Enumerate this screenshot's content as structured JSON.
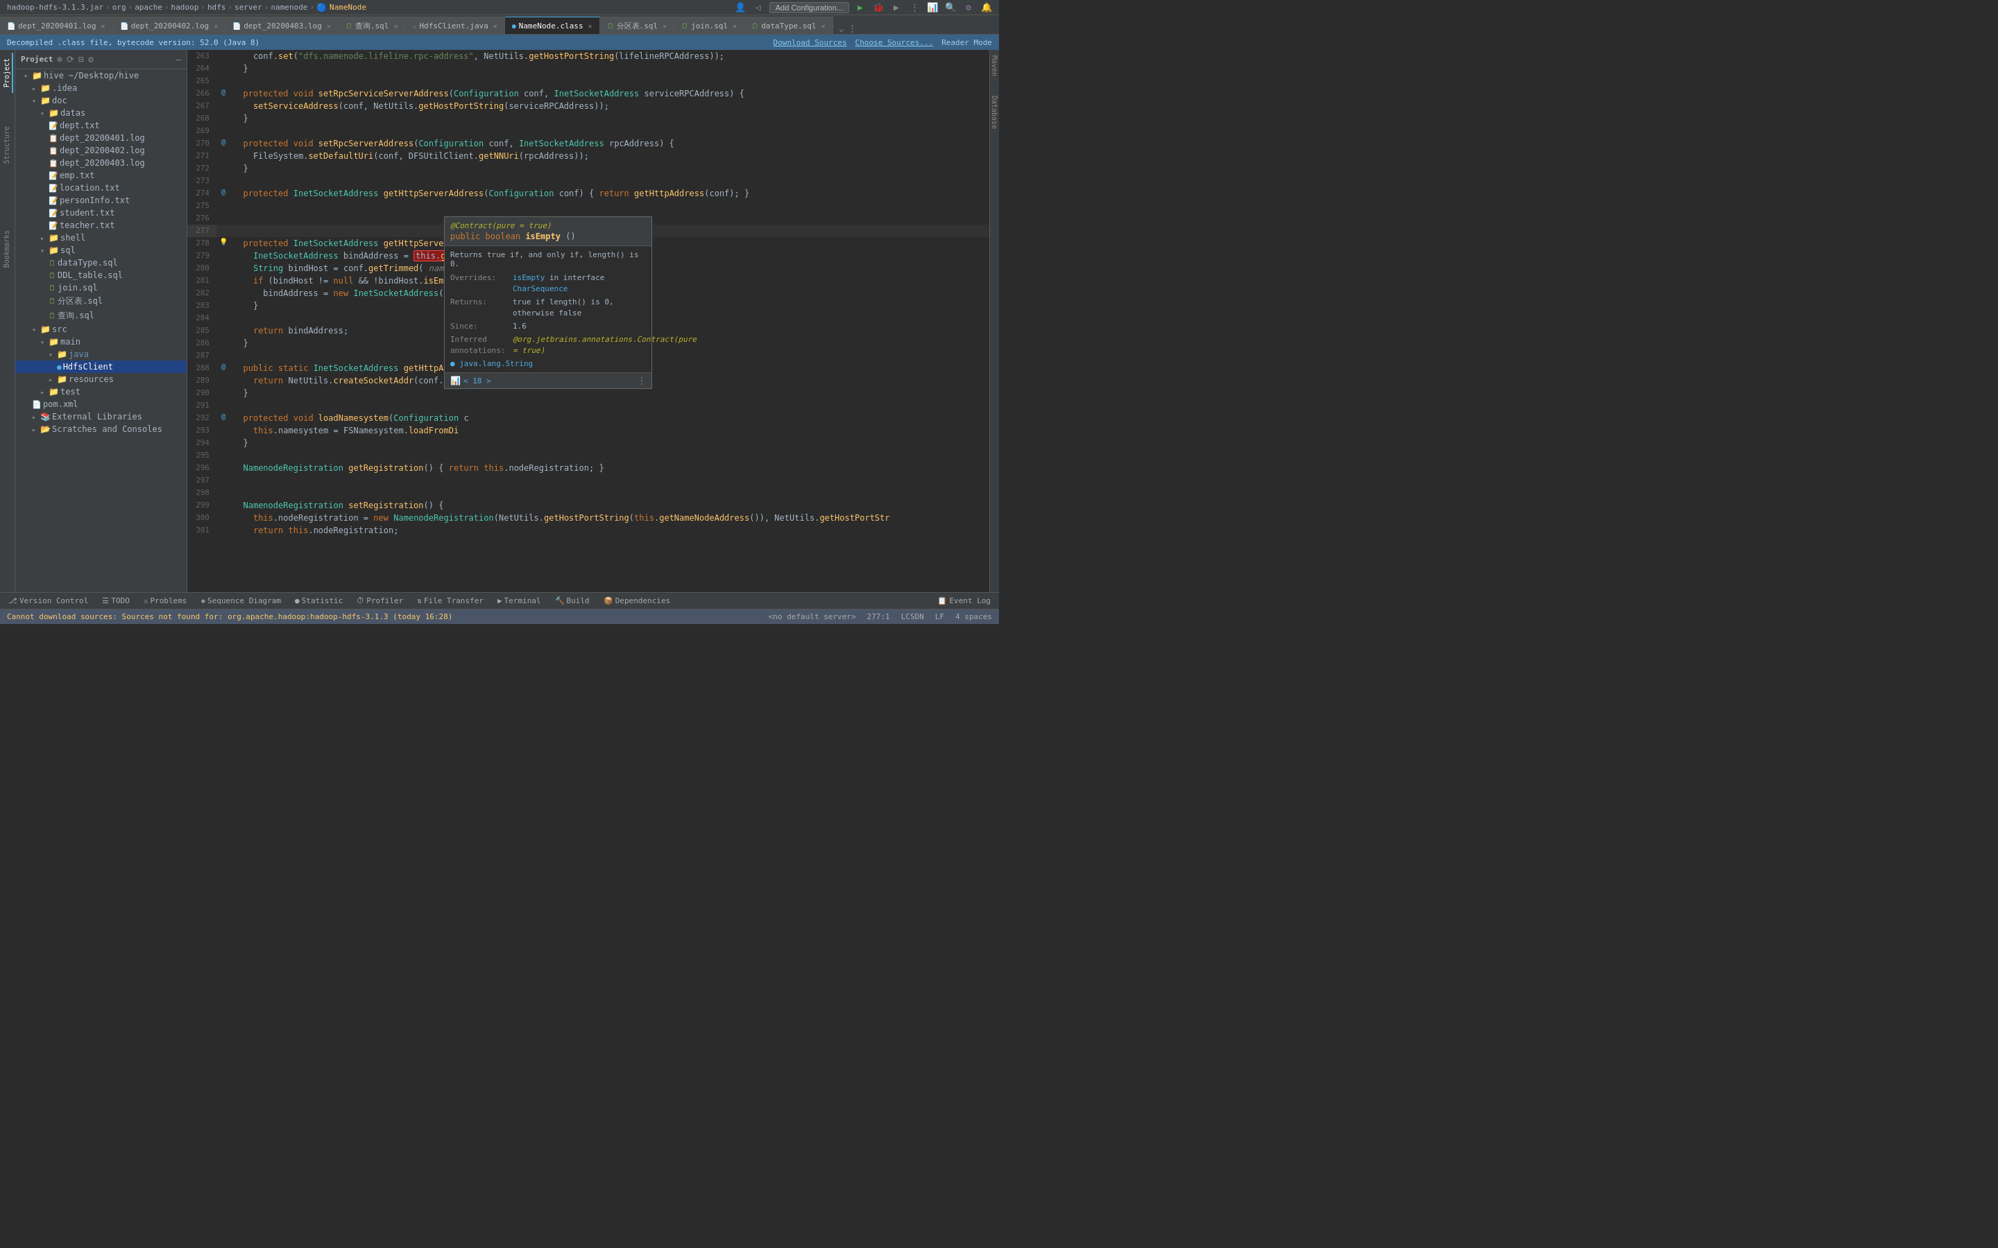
{
  "topbar": {
    "breadcrumb": [
      "hadoop-hdfs-3.1.3.jar",
      "org",
      "apache",
      "hadoop",
      "hdfs",
      "server",
      "namenode",
      "NameNode"
    ],
    "active_file": "NameNode",
    "add_config_btn": "Add Configuration...",
    "separators": [
      ">",
      ">",
      ">",
      ">",
      ">",
      ">",
      ">"
    ]
  },
  "tabs": [
    {
      "id": "tab1",
      "label": "dept_20200401.log",
      "type": "log",
      "active": false
    },
    {
      "id": "tab2",
      "label": "dept_20200402.log",
      "type": "log",
      "active": false
    },
    {
      "id": "tab3",
      "label": "dept_20200403.log",
      "type": "log",
      "active": false
    },
    {
      "id": "tab4",
      "label": "查询.sql",
      "type": "sql",
      "active": false
    },
    {
      "id": "tab5",
      "label": "HdfsClient.java",
      "type": "java",
      "active": false
    },
    {
      "id": "tab6",
      "label": "NameNode.class",
      "type": "class",
      "active": true
    },
    {
      "id": "tab7",
      "label": "分区表.sql",
      "type": "sql",
      "active": false
    },
    {
      "id": "tab8",
      "label": "join.sql",
      "type": "sql",
      "active": false
    },
    {
      "id": "tab9",
      "label": "dataType.sql",
      "type": "sql",
      "active": false
    }
  ],
  "infobar": {
    "text": "Decompiled .class file, bytecode version: 52.0 (Java 8)",
    "download_sources": "Download Sources",
    "choose_sources": "Choose Sources...",
    "reader_mode": "Reader Mode"
  },
  "sidebar": {
    "title": "Project",
    "root": {
      "label": "hive ~/Desktop/hive",
      "children": [
        {
          "label": ".idea",
          "type": "folder",
          "expanded": false
        },
        {
          "label": "doc",
          "type": "folder",
          "expanded": true,
          "children": [
            {
              "label": "datas",
              "type": "folder",
              "expanded": true,
              "children": [
                {
                  "label": "dept.txt",
                  "type": "txt"
                },
                {
                  "label": "dept_20200401.log",
                  "type": "log"
                },
                {
                  "label": "dept_20200402.log",
                  "type": "log"
                },
                {
                  "label": "dept_20200403.log",
                  "type": "log"
                },
                {
                  "label": "emp.txt",
                  "type": "txt"
                },
                {
                  "label": "location.txt",
                  "type": "txt"
                },
                {
                  "label": "personInfo.txt",
                  "type": "txt"
                },
                {
                  "label": "student.txt",
                  "type": "txt"
                },
                {
                  "label": "teacher.txt",
                  "type": "txt"
                }
              ]
            },
            {
              "label": "shell",
              "type": "folder",
              "expanded": false
            },
            {
              "label": "sql",
              "type": "folder",
              "expanded": true,
              "children": [
                {
                  "label": "dataType.sql",
                  "type": "sql"
                },
                {
                  "label": "DDL_table.sql",
                  "type": "sql"
                },
                {
                  "label": "join.sql",
                  "type": "sql"
                },
                {
                  "label": "分区表.sql",
                  "type": "sql"
                },
                {
                  "label": "查询.sql",
                  "type": "sql"
                }
              ]
            }
          ]
        },
        {
          "label": "src",
          "type": "folder",
          "expanded": true,
          "children": [
            {
              "label": "main",
              "type": "folder",
              "expanded": true,
              "children": [
                {
                  "label": "java",
                  "type": "folder",
                  "expanded": true,
                  "children": [
                    {
                      "label": "HdfsClient",
                      "type": "java",
                      "selected": true
                    }
                  ]
                },
                {
                  "label": "resources",
                  "type": "folder",
                  "expanded": false
                }
              ]
            },
            {
              "label": "test",
              "type": "folder",
              "expanded": false
            }
          ]
        },
        {
          "label": "pom.xml",
          "type": "xml"
        },
        {
          "label": "External Libraries",
          "type": "folder",
          "expanded": false
        },
        {
          "label": "Scratches and Consoles",
          "type": "folder",
          "expanded": false
        }
      ]
    }
  },
  "code": {
    "lines": [
      {
        "num": "263",
        "content": "    conf.set(\"dfs.namenode.lifeline.rpc-address\", NetUtils.getHostPortString(lifelineRPCAddress));"
      },
      {
        "num": "264",
        "content": "  }"
      },
      {
        "num": "265",
        "content": ""
      },
      {
        "num": "266",
        "content": "  protected void setRpcServiceServerAddress(Configuration conf, InetSocketAddress serviceRPCAddress) {",
        "gutter": "annot"
      },
      {
        "num": "267",
        "content": "    setServiceAddress(conf, NetUtils.getHostPortString(serviceRPCAddress));"
      },
      {
        "num": "268",
        "content": "  }"
      },
      {
        "num": "269",
        "content": ""
      },
      {
        "num": "270",
        "content": "  protected void setRpcServerAddress(Configuration conf, InetSocketAddress rpcAddress) {",
        "gutter": "annot"
      },
      {
        "num": "271",
        "content": "    FileSystem.setDefaultUri(conf, DFSUtilClient.getNNUri(rpcAddress));"
      },
      {
        "num": "272",
        "content": "  }"
      },
      {
        "num": "273",
        "content": ""
      },
      {
        "num": "274",
        "content": "  protected InetSocketAddress getHttpServerAddress(Configuration conf) { return getHttpAddress(conf); }",
        "gutter": "annot"
      },
      {
        "num": "275",
        "content": ""
      },
      {
        "num": "276",
        "content": ""
      },
      {
        "num": "277",
        "content": ""
      },
      {
        "num": "278",
        "content": "  protected InetSocketAddress getHttpServerBindAddress(Configuration conf) {",
        "gutter": "bulb"
      },
      {
        "num": "279",
        "content": "    InetSocketAddress bindAddress = this.getHttpServerAddress(conf);",
        "highlight": true
      },
      {
        "num": "280",
        "content": "    String bindHost = conf.getTrimmed( name: \"dfs.namenode.http-bind-host\");"
      },
      {
        "num": "281",
        "content": "    if (bindHost != null && !bindHost.isEmpty()) {"
      },
      {
        "num": "282",
        "content": "      bindAddress = new InetSocketAddress(b"
      },
      {
        "num": "283",
        "content": "    }"
      },
      {
        "num": "284",
        "content": ""
      },
      {
        "num": "285",
        "content": "    return bindAddress;"
      },
      {
        "num": "286",
        "content": "  }"
      },
      {
        "num": "287",
        "content": ""
      },
      {
        "num": "288",
        "content": "  @ public static InetSocketAddress getHttpAddres",
        "gutter": "annot"
      },
      {
        "num": "289",
        "content": "    return NetUtils.createSocketAddr(conf.get"
      },
      {
        "num": "290",
        "content": "  }"
      },
      {
        "num": "291",
        "content": ""
      },
      {
        "num": "292",
        "content": "  protected void loadNamesystem(Configuration c",
        "gutter": "annot"
      },
      {
        "num": "293",
        "content": "    this.namesystem = FSNamesystem.loadFromDi"
      },
      {
        "num": "294",
        "content": "  }"
      },
      {
        "num": "295",
        "content": ""
      },
      {
        "num": "296",
        "content": "  NamenodeRegistration getRegistration() { return this.nodeRegistration; }"
      },
      {
        "num": "297",
        "content": ""
      },
      {
        "num": "298",
        "content": ""
      },
      {
        "num": "299",
        "content": "  NamenodeRegistration setRegistration() {"
      },
      {
        "num": "300",
        "content": "    this.nodeRegistration = new NamenodeRegistration(NetUtils.getHostPortString(this.getNameNodeAddress()), NetUtils.getHostPortStr"
      },
      {
        "num": "301",
        "content": "    return this.nodeRegistration;"
      }
    ]
  },
  "tooltip": {
    "annotations": "@Contract(pure = true)",
    "signature": "public boolean isEmpty()",
    "description": "Returns true if, and only if, length() is 0.",
    "overrides_label": "Overrides:",
    "overrides_method": "isEmpty",
    "overrides_interface": "in interface",
    "overrides_type": "CharSequence",
    "returns_label": "Returns:",
    "returns_val": "true if length() is 0, otherwise false",
    "since_label": "Since:",
    "since_val": "1.6",
    "inferred_label": "Inferred annotations:",
    "inferred_val": "@org.jetbrains.annotations.Contract(pure = true)",
    "java_type": "java.lang.String",
    "more": "< 18 >"
  },
  "bottom_toolbar": {
    "items": [
      {
        "label": "Version Control",
        "icon": "⎇"
      },
      {
        "label": "TODO",
        "icon": "☰"
      },
      {
        "label": "Problems",
        "icon": "⚠"
      },
      {
        "label": "Sequence Diagram",
        "icon": "◈"
      },
      {
        "label": "Statistic",
        "icon": "📊"
      },
      {
        "label": "Profiler",
        "icon": "⏱"
      },
      {
        "label": "File Transfer",
        "icon": "⇅"
      },
      {
        "label": "Terminal",
        "icon": ">"
      },
      {
        "label": "Build",
        "icon": "🔨"
      },
      {
        "label": "Dependencies",
        "icon": "📦"
      },
      {
        "label": "Event Log",
        "icon": "📋"
      }
    ]
  },
  "statusbar": {
    "error_msg": "Cannot download sources: Sources not found for: org.apache.hadoop:hadoop-hdfs-3.1.3 (today 16:28)",
    "server": "<no default server>",
    "line_col": "277:1",
    "encoding": "LCSDN",
    "line_sep": "LF",
    "indent": "4 spaces"
  },
  "left_tabs": [
    "Project",
    "Structure",
    "Bookmarks"
  ],
  "right_tabs": [
    "Maven",
    "Database"
  ]
}
